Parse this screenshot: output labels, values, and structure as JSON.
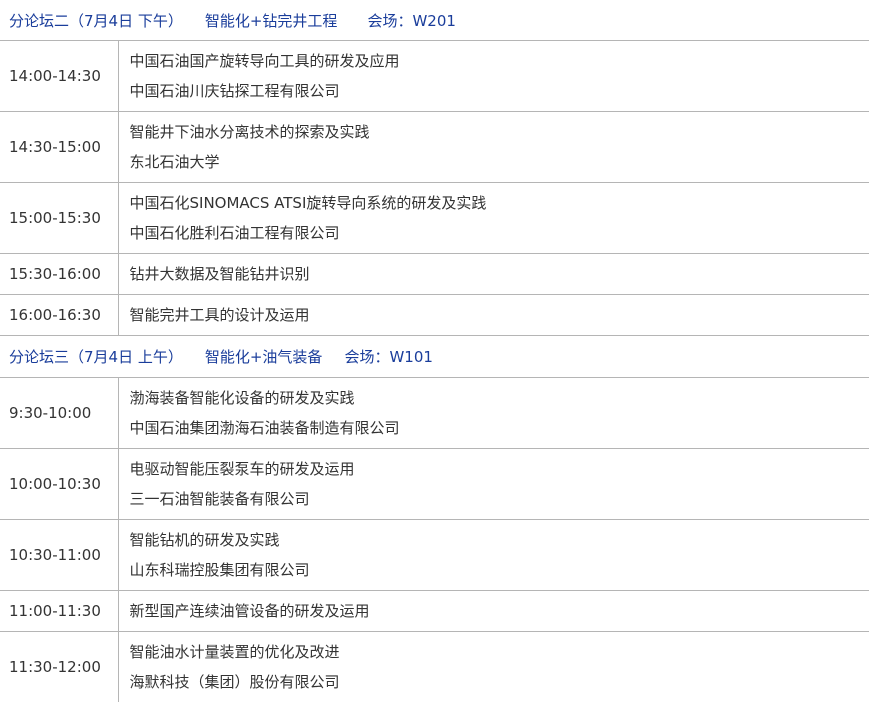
{
  "sessions": [
    {
      "title": "分论坛二（7月4日  下午）",
      "topic": "智能化+钻完井工程",
      "venue": "会场：W201",
      "items": [
        {
          "time": "14:00-14:30",
          "talk": "中国石油国产旋转导向工具的研发及应用",
          "org": "中国石油川庆钻探工程有限公司"
        },
        {
          "time": "14:30-15:00",
          "talk": "智能井下油水分离技术的探索及实践",
          "org": "东北石油大学"
        },
        {
          "time": "15:00-15:30",
          "talk": "中国石化SINOMACS ATSI旋转导向系统的研发及实践",
          "org": "中国石化胜利石油工程有限公司"
        },
        {
          "time": "15:30-16:00",
          "talk": "钻井大数据及智能钻井识别"
        },
        {
          "time": "16:00-16:30",
          "talk": "智能完井工具的设计及运用"
        }
      ]
    },
    {
      "title": "分论坛三（7月4日  上午）",
      "topic": "智能化+油气装备",
      "venue": "会场：W101",
      "items": [
        {
          "time": "9:30-10:00",
          "talk": "渤海装备智能化设备的研发及实践",
          "org": "中国石油集团渤海石油装备制造有限公司"
        },
        {
          "time": "10:00-10:30",
          "talk": "电驱动智能压裂泵车的研发及运用",
          "org": "三一石油智能装备有限公司"
        },
        {
          "time": "10:30-11:00",
          "talk": "智能钻机的研发及实践",
          "org": "山东科瑞控股集团有限公司"
        },
        {
          "time": "11:00-11:30",
          "talk": "新型国产连续油管设备的研发及运用"
        },
        {
          "time": "11:30-12:00",
          "talk": "智能油水计量装置的优化及改进",
          "org": "海默科技（集团）股份有限公司"
        }
      ]
    }
  ]
}
